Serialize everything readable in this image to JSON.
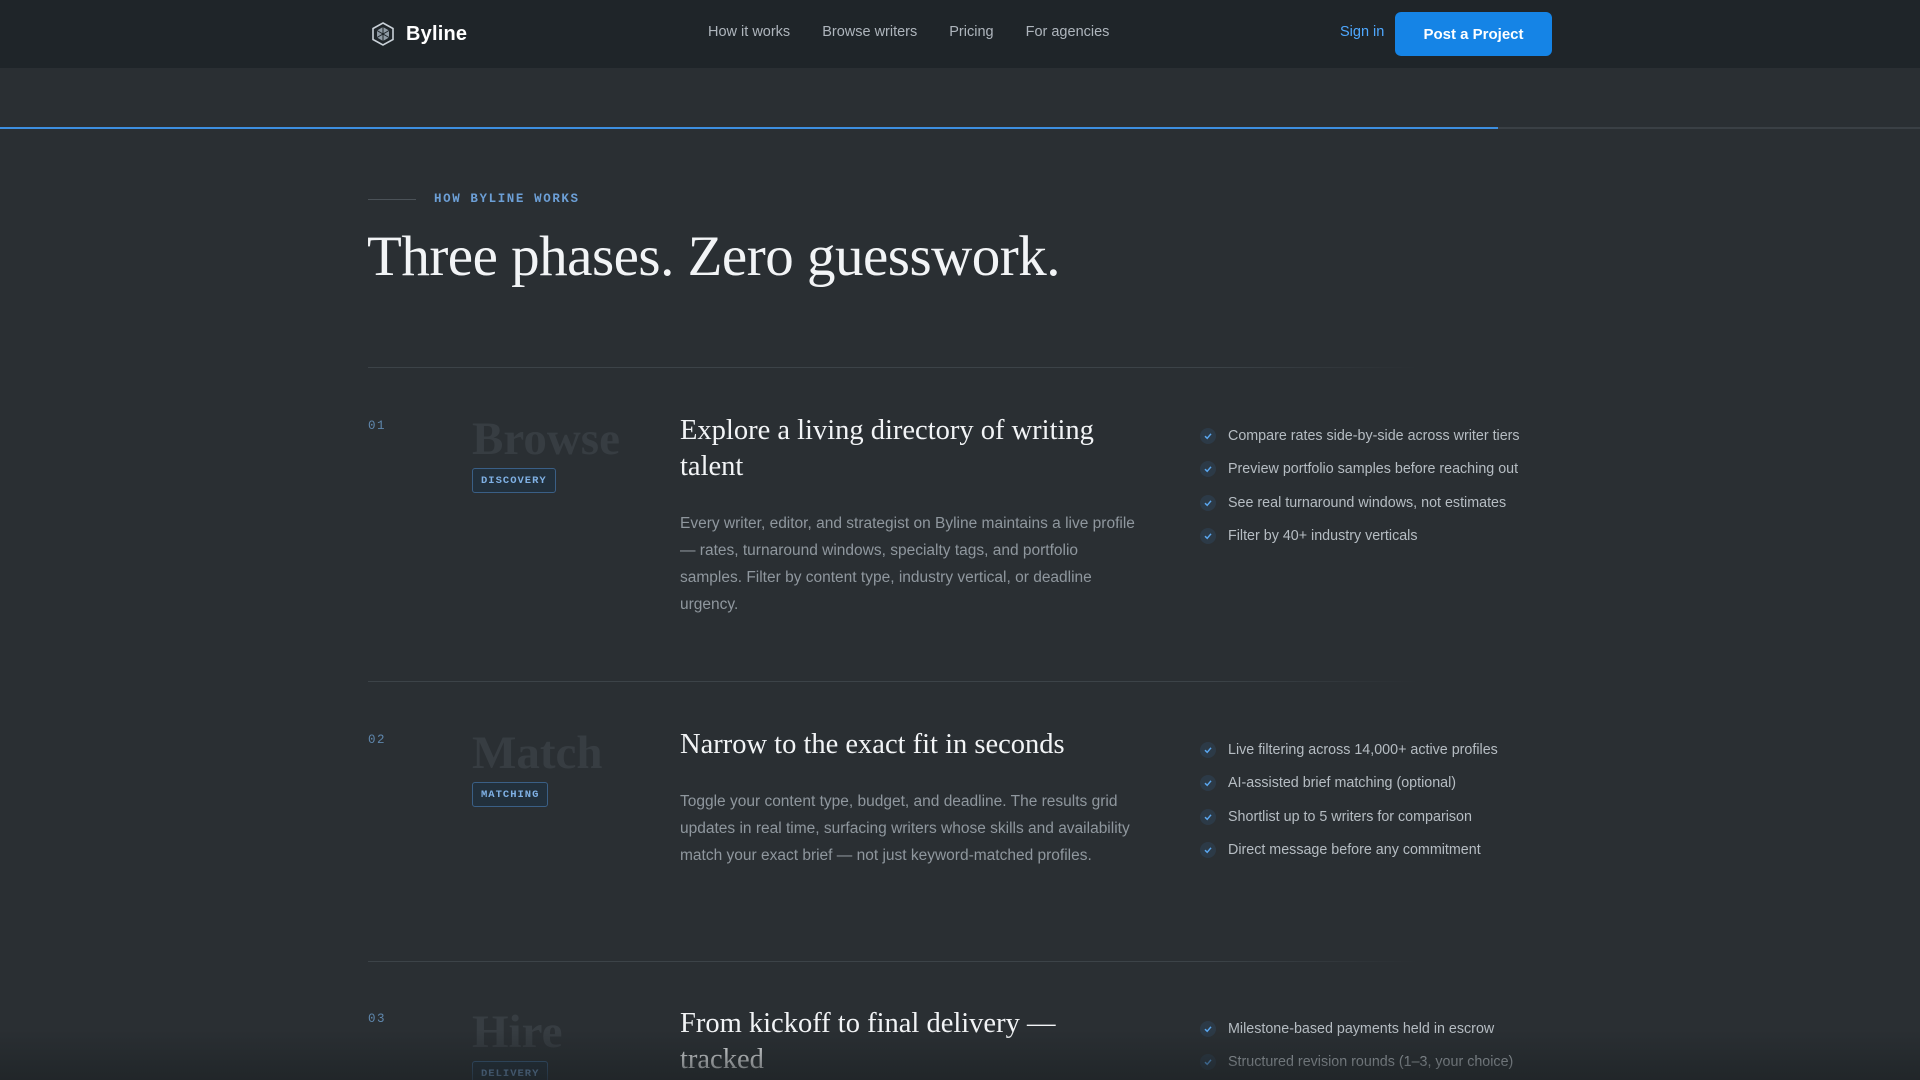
{
  "nav": {
    "brand": "Byline",
    "links": [
      "How it works",
      "Browse writers",
      "Pricing",
      "For agencies"
    ],
    "signin": "Sign in",
    "cta": "Post a Project"
  },
  "progress": {
    "fraction": 0.78
  },
  "section": {
    "eyebrow": "HOW BYLINE WORKS",
    "title": "Three phases. Zero guesswork."
  },
  "phases": [
    {
      "num": "01",
      "word": "Browse",
      "tag": "DISCOVERY",
      "heading": "Explore a living directory of writing talent",
      "desc": "Every writer, editor, and strategist on Byline maintains a live profile — rates, turnaround windows, specialty tags, and portfolio samples. Filter by content type, industry vertical, or deadline urgency.",
      "checks": [
        "Compare rates side-by-side across writer tiers",
        "Preview portfolio samples before reaching out",
        "See real turnaround windows, not estimates",
        "Filter by 40+ industry verticals"
      ]
    },
    {
      "num": "02",
      "word": "Match",
      "tag": "MATCHING",
      "heading": "Narrow to the exact fit in seconds",
      "desc": "Toggle your content type, budget, and deadline. The results grid updates in real time, surfacing writers whose skills and availability match your exact brief — not just keyword-matched profiles.",
      "checks": [
        "Live filtering across 14,000+ active profiles",
        "AI-assisted brief matching (optional)",
        "Shortlist up to 5 writers for comparison",
        "Direct message before any commitment"
      ]
    },
    {
      "num": "03",
      "word": "Hire",
      "tag": "DELIVERY",
      "heading": "From kickoff to final delivery — tracked",
      "desc": "",
      "checks": [
        "Milestone-based payments held in escrow",
        "Structured revision rounds (1–3, your choice)"
      ]
    }
  ],
  "colors": {
    "background": "#2a2f33",
    "nav": "#1f2529",
    "accent": "#1584e6",
    "link": "#4ea8ff"
  },
  "icons": {
    "brand": "hexagon-logo-icon",
    "check": "check-circle-icon"
  }
}
